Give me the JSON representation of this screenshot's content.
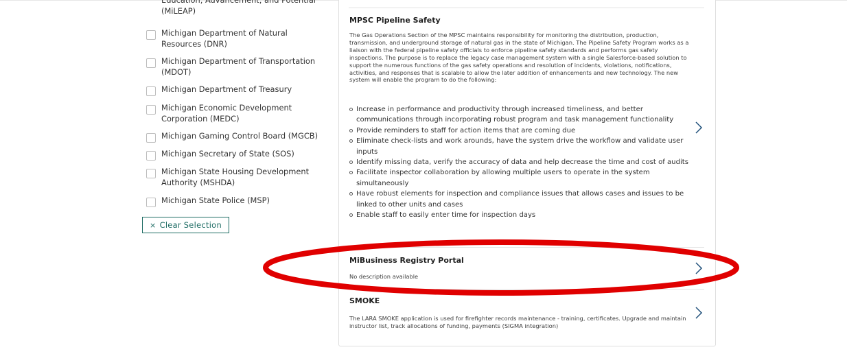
{
  "filters": {
    "items": [
      {
        "label": "Education, Advancement, and Potential (MiLEAP)",
        "checked": false
      },
      {
        "label": "Michigan Department of Natural Resources (DNR)",
        "checked": false
      },
      {
        "label": "Michigan Department of Transportation (MDOT)",
        "checked": false
      },
      {
        "label": "Michigan Department of Treasury",
        "checked": false
      },
      {
        "label": "Michigan Economic Development Corporation (MEDC)",
        "checked": false
      },
      {
        "label": "Michigan Gaming Control Board (MGCB)",
        "checked": false
      },
      {
        "label": "Michigan Secretary of State (SOS)",
        "checked": false
      },
      {
        "label": "Michigan State Housing Development Authority (MSHDA)",
        "checked": false
      },
      {
        "label": "Michigan State Police (MSP)",
        "checked": false
      }
    ],
    "clear_icon": "×",
    "clear_label": "Clear Selection"
  },
  "results": {
    "mpsc": {
      "title": "MPSC Pipeline Safety",
      "description": "The Gas Operations Section of the MPSC maintains responsibility for monitoring the distribution, production, transmission, and underground storage of natural gas in the state of Michigan. The Pipeline Safety Program works as a liaison with the federal pipeline safety officials to enforce pipeline safety standards and performs gas safety inspections. The purpose is to replace the legacy case management system with a single Salesforce-based solution to support the numerous functions of the gas safety operations and resolution of incidents, violations, notifications, activities, and responses that is scalable to allow the later addition of enhancements and new technology. The new system will enable the program to do the following:",
      "bullets": [
        "Increase in performance and productivity through increased timeliness, and better communications through incorporating robust program and task management functionality",
        "Provide reminders to staff for action items that are coming due",
        "Eliminate check-lists and work arounds, have the system drive the workflow and validate user inputs",
        "Identify missing data, verify the accuracy of data and help decrease the time and cost of audits",
        "Facilitate inspector collaboration by allowing multiple users to operate in the system simultaneously",
        "Have robust elements for inspection and compliance issues that allows cases and issues to be linked to other units and cases",
        "Enable staff to easily enter time for inspection days"
      ],
      "chevron_icon": "chevron-right-icon"
    },
    "mibusiness": {
      "title": "MiBusiness Registry Portal",
      "description": "No description available",
      "chevron_icon": "chevron-right-icon"
    },
    "smoke": {
      "title": "SMOKE",
      "description": "The LARA SMOKE application is used for firefighter records maintenance - training, certificates. Upgrade and maintain instructor list, track allocations of funding, payments (SIGMA integration)",
      "chevron_icon": "chevron-right-icon"
    }
  },
  "colors": {
    "accent": "#1b6a62",
    "annotation": "#e00000",
    "chevron": "#1f4f7a"
  }
}
